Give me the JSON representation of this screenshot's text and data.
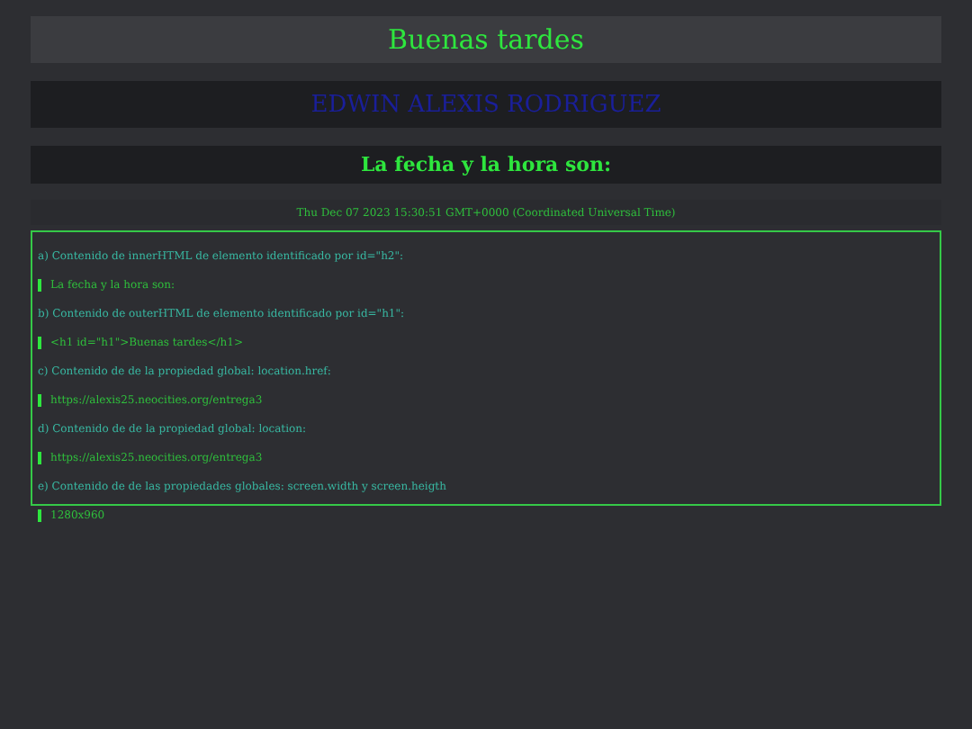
{
  "greeting": "Buenas tardes",
  "name": "EDWIN ALEXIS RODRIGUEZ",
  "date_heading": "La fecha y la hora son:",
  "date_text": "Thu Dec 07 2023 15:30:51 GMT+0000 (Coordinated Universal Time)",
  "items": [
    {
      "question": "a) Contenido de innerHTML de elemento identificado por id=\"h2\":",
      "answer": "La fecha y la hora son:"
    },
    {
      "question": "b) Contenido de outerHTML de elemento identificado por id=\"h1\":",
      "answer": "<h1 id=\"h1\">Buenas tardes</h1>"
    },
    {
      "question": "c) Contenido de de la propiedad global: location.href:",
      "answer": "https://alexis25.neocities.org/entrega3"
    },
    {
      "question": "d) Contenido de de la propiedad global: location:",
      "answer": "https://alexis25.neocities.org/entrega3"
    },
    {
      "question": "e) Contenido de de las propiedades globales: screen.width y screen.heigth",
      "answer": "1280x960"
    }
  ]
}
